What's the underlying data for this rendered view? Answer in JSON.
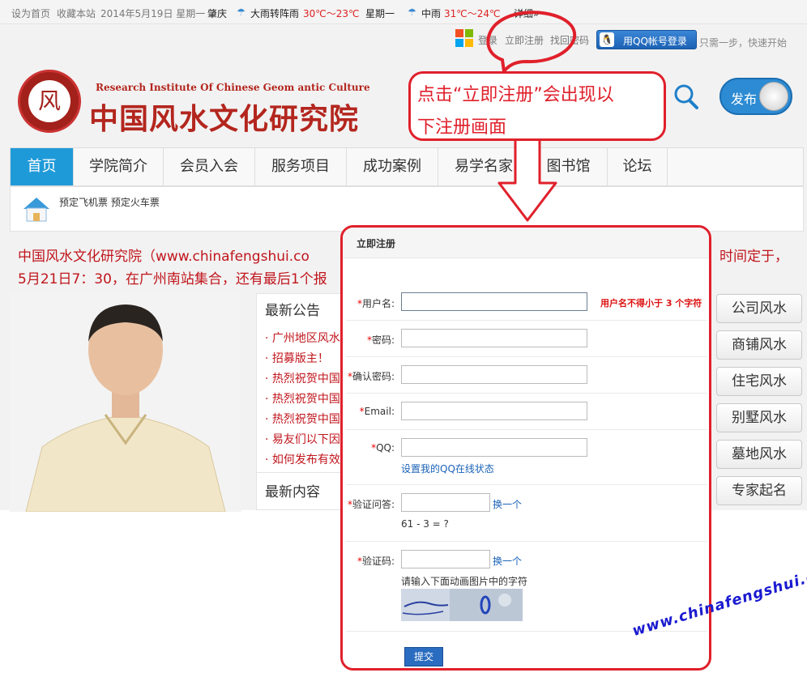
{
  "topbar": {
    "set_home": "设为首页",
    "bookmark": "收藏本站",
    "date": "2014年5月19日 星期一",
    "city": "肇庆",
    "weather1": "大雨转阵雨",
    "temp1": "30℃～23℃",
    "weekday2": "星期一",
    "weather2": "中雨",
    "temp2": "31℃～24℃",
    "details": "详细»"
  },
  "login": {
    "login": "登录",
    "register": "立即注册",
    "find_password": "找回密码",
    "qq_login": "用QQ帐号登录",
    "one_step": "只需一步，快速开始"
  },
  "brand": {
    "english": "Research Institute Of Chinese Geom antic Culture",
    "title": "中国风水文化研究院"
  },
  "toggle": {
    "label": "发布"
  },
  "nav": [
    "首页",
    "学院简介",
    "会员入会",
    "服务项目",
    "成功案例",
    "易学名家",
    "图书馆",
    "论坛"
  ],
  "subnav": {
    "links": "预定飞机票 预定火车票"
  },
  "notice": {
    "line1_start": "中国风水文化研究院（www.chinafengshui.co",
    "line1_end": "时间定于，",
    "line2": "5月21日7：30，在广州南站集合，还有最后1个报"
  },
  "announcements": {
    "title": "最新公告",
    "items": [
      "广州地区风水",
      "招募版主！",
      "热烈祝贺中国",
      "热烈祝贺中国",
      "热烈祝贺中国",
      "易友们以下因",
      "如何发布有效"
    ],
    "latest_title": "最新内容"
  },
  "side_buttons": [
    "公司风水",
    "商铺风水",
    "住宅风水",
    "别墅风水",
    "墓地风水",
    "专家起名"
  ],
  "callout": {
    "line1": "点击“立即注册”会出现以",
    "line2": "下注册画面"
  },
  "register": {
    "title": "立即注册",
    "username_label": "用户名:",
    "username_tip": "用户名不得小于 3 个字符",
    "password_label": "密码:",
    "confirm_label": "确认密码:",
    "email_label": "Email:",
    "qq_label": "QQ:",
    "qq_status_link": "设置我的QQ在线状态",
    "question_label": "验证问答:",
    "change": "换一个",
    "question": "61 - 3 = ?",
    "captcha_label": "验证码:",
    "captcha_hint": "请输入下面动画图片中的字符",
    "submit": "提交"
  },
  "watermark": "www.chinafengshui.com",
  "colors": {
    "accent_red": "#e0202b",
    "nav_active": "#1f9ad8",
    "brand_red": "#b3261e"
  }
}
